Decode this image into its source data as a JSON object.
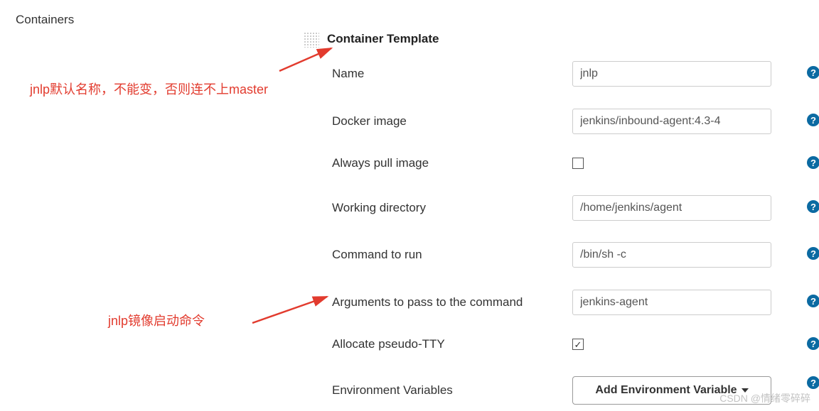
{
  "section": {
    "title": "Containers"
  },
  "template": {
    "title": "Container Template"
  },
  "fields": {
    "name": {
      "label": "Name",
      "value": "jnlp"
    },
    "dockerImage": {
      "label": "Docker image",
      "value": "jenkins/inbound-agent:4.3-4"
    },
    "alwaysPull": {
      "label": "Always pull image",
      "checked": false
    },
    "workingDir": {
      "label": "Working directory",
      "value": "/home/jenkins/agent"
    },
    "command": {
      "label": "Command to run",
      "value": "/bin/sh -c"
    },
    "arguments": {
      "label": "Arguments to pass to the command",
      "value": "jenkins-agent"
    },
    "allocateTty": {
      "label": "Allocate pseudo-TTY",
      "checked": true
    },
    "envVars": {
      "label": "Environment Variables",
      "button": "Add Environment Variable"
    }
  },
  "annotations": {
    "name_note": "jnlp默认名称，不能变，否则连不上master",
    "args_note": "jnlp镜像启动命令"
  },
  "help": "?",
  "watermark": "CSDN @情绪零碎碎"
}
